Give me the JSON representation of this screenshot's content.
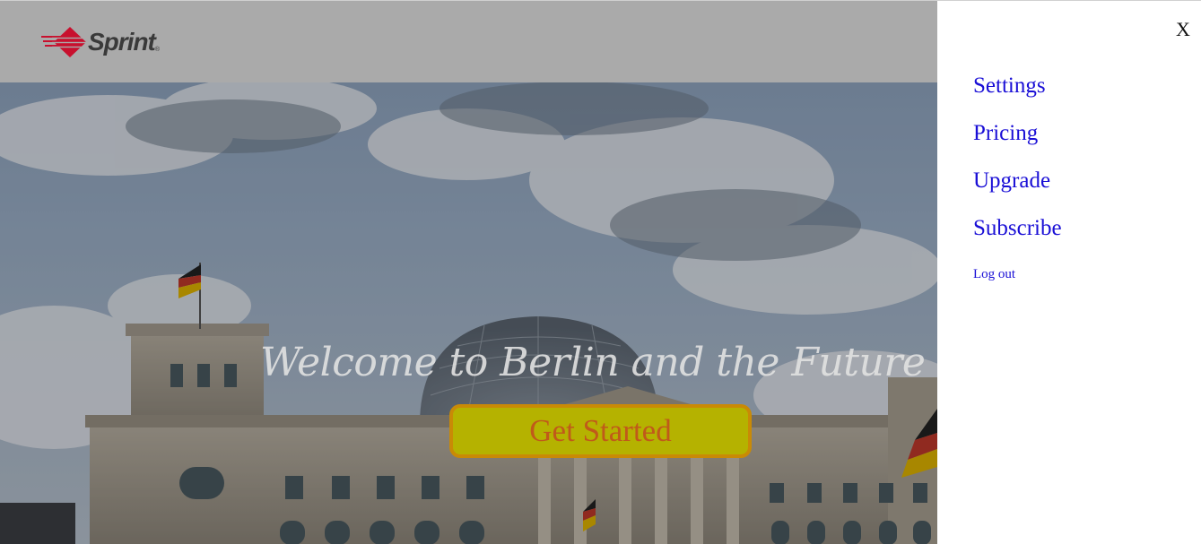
{
  "header": {
    "logo_text": "Sprint",
    "logo_reg": "®",
    "logo_icon": "sprint-diamond-logo",
    "background_color": "#aaaaaa"
  },
  "hero": {
    "title": "Welcome to Berlin and the Future",
    "cta_label": "Get Started",
    "cta_background": "#b5b200",
    "cta_border": "#c98a06",
    "cta_text_color": "#c05a1a",
    "image_subject": "reichstag-building"
  },
  "side_panel": {
    "close_label": "X",
    "link_color": "#1a0fd6",
    "nav_items": [
      {
        "label": "Settings"
      },
      {
        "label": "Pricing"
      },
      {
        "label": "Upgrade"
      },
      {
        "label": "Subscribe"
      },
      {
        "label": "Log out"
      }
    ]
  }
}
